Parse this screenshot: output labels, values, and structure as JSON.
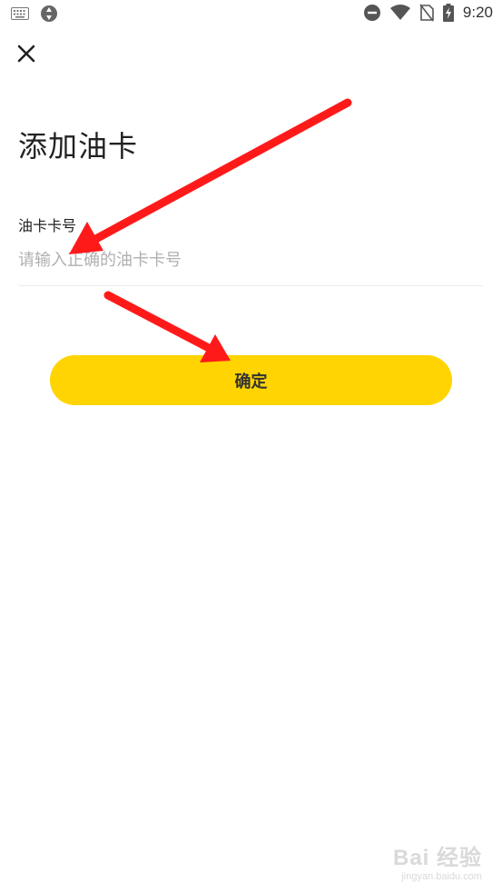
{
  "status_bar": {
    "time": "9:20",
    "icons": [
      "keyboard-icon",
      "sync-icon",
      "do-not-disturb-icon",
      "wifi-icon",
      "no-sim-icon",
      "battery-charging-icon"
    ]
  },
  "header": {
    "close_icon": "close-icon"
  },
  "page": {
    "title": "添加油卡"
  },
  "form": {
    "card_number_label": "油卡卡号",
    "card_number_placeholder": "请输入正确的油卡卡号",
    "card_number_value": ""
  },
  "actions": {
    "confirm_label": "确定"
  },
  "colors": {
    "accent": "#FFD400",
    "annotation_arrow": "#FF1A1A"
  },
  "watermark": {
    "logo": "Bai 经验",
    "url": "jingyan.baidu.com"
  }
}
